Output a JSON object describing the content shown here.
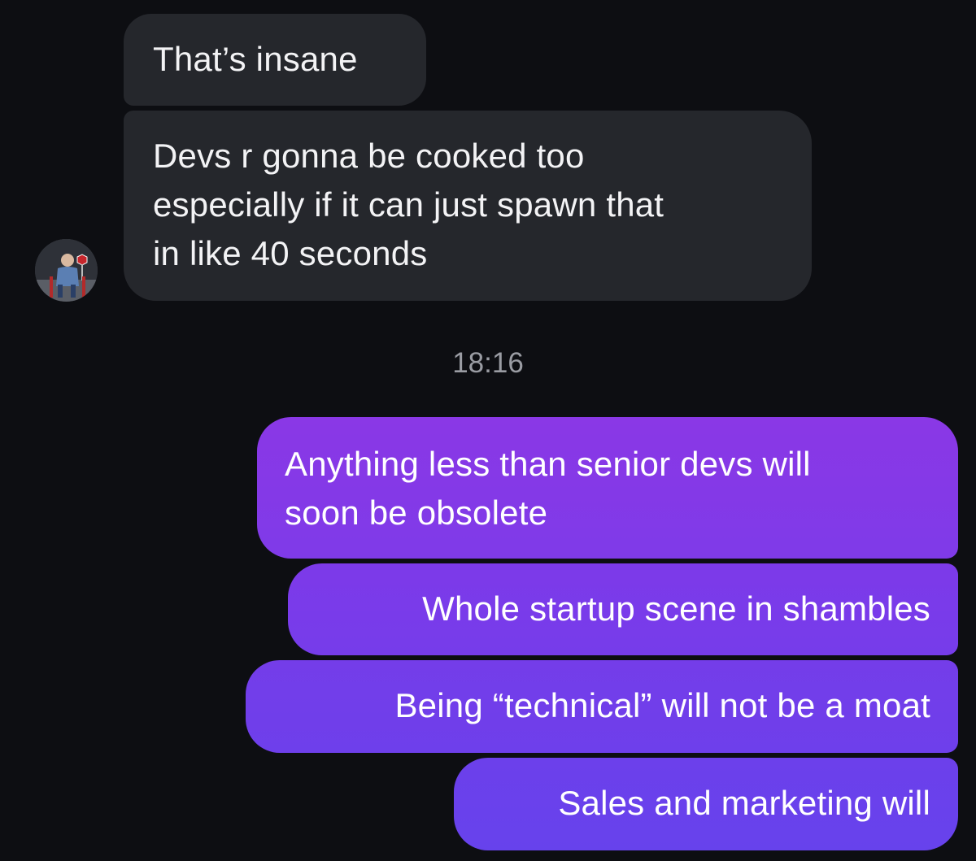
{
  "conversation": {
    "incoming": [
      {
        "text": "That’s insane"
      },
      {
        "lines": [
          "Devs r gonna be cooked too",
          "especially if it can just spawn that",
          "in like 40 seconds"
        ]
      }
    ],
    "avatar_icon": "person-with-stop-sign-avatar",
    "timestamp": "18:16",
    "outgoing": [
      {
        "lines": [
          "Anything less than senior devs will",
          "soon be obsolete"
        ]
      },
      {
        "text": "Whole startup scene in shambles"
      },
      {
        "text": "Being “technical” will not be a moat"
      },
      {
        "text": "Sales and marketing will"
      }
    ]
  },
  "colors": {
    "background": "#0d0e12",
    "incoming_bubble": "#25272c",
    "outgoing_bubble_top": "#8a38e6",
    "outgoing_bubble_bottom": "#6742ec",
    "timestamp": "#9a9ca3"
  }
}
